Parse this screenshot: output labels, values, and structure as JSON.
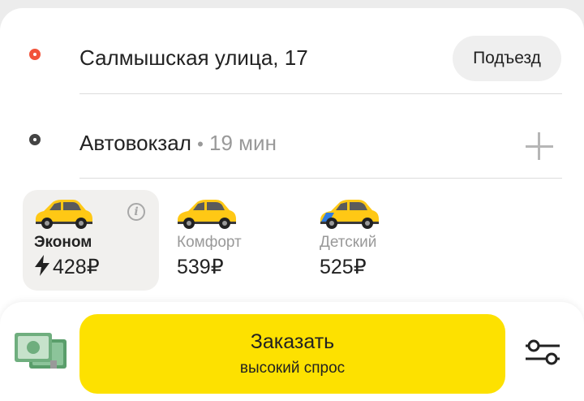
{
  "route": {
    "from": {
      "address": "Салмышская улица, 17",
      "entrance_button": "Подъезд"
    },
    "to": {
      "address": "Автовокзал",
      "separator": "•",
      "eta": "19 мин",
      "add_icon": "plus-icon"
    }
  },
  "tariffs": [
    {
      "name": "Эконом",
      "price": "428₽",
      "selected": true,
      "surge_icon": "lightning-icon",
      "info_icon": "info-icon"
    },
    {
      "name": "Комфорт",
      "price": "539₽",
      "selected": false
    },
    {
      "name": "Детский",
      "price": "525₽",
      "selected": false
    }
  ],
  "order": {
    "button_label": "Заказать",
    "button_sublabel": "высокий спрос",
    "payment_icon": "cash-icon",
    "settings_icon": "sliders-icon"
  },
  "colors": {
    "accent_yellow": "#fde100",
    "from_dot": "#f2533a",
    "car_yellow": "#ffc815"
  }
}
